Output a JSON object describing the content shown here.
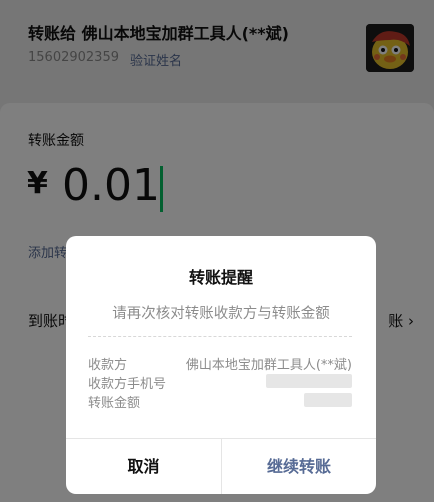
{
  "header": {
    "recipient_title": "转账给 佛山本地宝加群工具人(**斌)",
    "phone": "15602902359",
    "verify_link": "验证姓名"
  },
  "amount_section": {
    "label": "转账金额",
    "currency": "¥",
    "amount": "0.01",
    "add_note": "添加转",
    "arrival_label": "到账时",
    "arrival_value": "账 ›"
  },
  "dialog": {
    "title": "转账提醒",
    "subtitle": "请再次核对转账收款方与转账金额",
    "rows": [
      {
        "key": "收款方",
        "value": "佛山本地宝加群工具人(**斌)"
      },
      {
        "key": "收款方手机号",
        "value": ""
      },
      {
        "key": "转账金额",
        "value": ""
      }
    ],
    "cancel_label": "取消",
    "confirm_label": "继续转账"
  },
  "colors": {
    "link": "#576b95",
    "cursor": "#07c160",
    "overlay": "rgba(0,0,0,0.5)"
  },
  "icons": [
    "avatar-image"
  ]
}
